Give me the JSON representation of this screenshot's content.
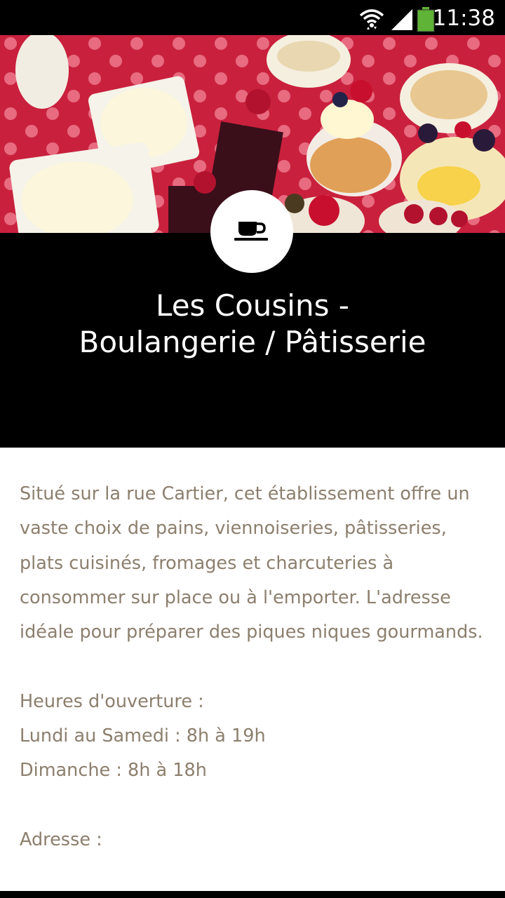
{
  "status_bar": {
    "time": "11:38",
    "icons": [
      "wifi-icon",
      "signal-icon",
      "battery-icon"
    ],
    "battery_color": "#5fb336"
  },
  "hero": {
    "image_description": "bakery display of pastries"
  },
  "header": {
    "icon": "coffee-cup-icon",
    "title_line1": "Les Cousins -",
    "title_line2": "Boulangerie / Pâtisserie"
  },
  "content": {
    "description": "Situé sur la rue Cartier, cet établissement offre un vaste choix de pains, viennoiseries, pâtisseries, plats cuisinés, fromages et charcuteries à consommer sur place ou à l'emporter.  L'adresse idéale pour préparer des piques niques gourmands.",
    "hours_label": "Heures d'ouverture :",
    "hours_weekdays": "Lundi au Samedi : 8h à 19h",
    "hours_sunday": "Dimanche : 8h à 18h",
    "address_label": "Adresse :"
  },
  "colors": {
    "text": "#8c7f6d",
    "header_bg": "#000000",
    "hero_bg": "#c9213d"
  }
}
